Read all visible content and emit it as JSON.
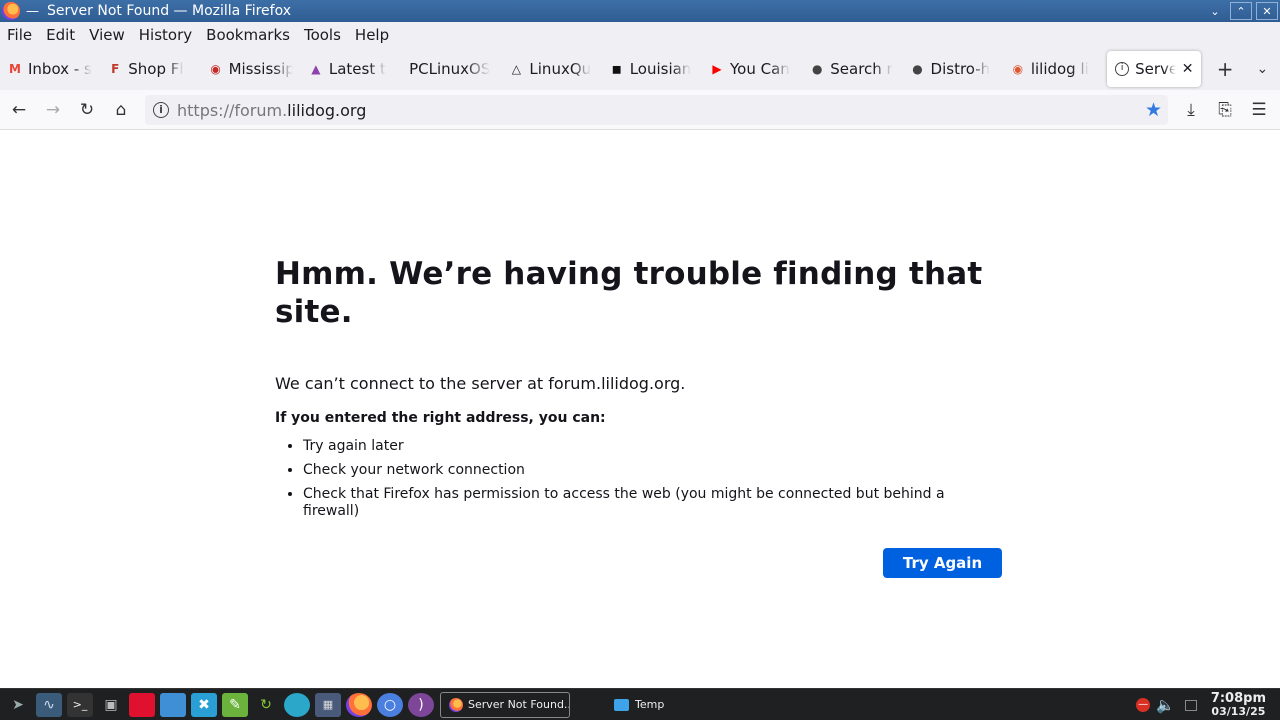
{
  "window": {
    "title": "Server Not Found — Mozilla Firefox"
  },
  "menu": [
    "File",
    "Edit",
    "View",
    "History",
    "Bookmarks",
    "Tools",
    "Help"
  ],
  "tabs": [
    {
      "label": "Inbox - s",
      "icon": "gmail-icon",
      "color": "#ea4335"
    },
    {
      "label": "Shop Fl",
      "icon": "shop-icon",
      "color": "#c0392b"
    },
    {
      "label": "Mississip",
      "icon": "mississippi-icon",
      "color": "#c62828"
    },
    {
      "label": "Latest t",
      "icon": "triangle-icon",
      "color": "#8e44ad"
    },
    {
      "label": "PCLinuxOS",
      "icon": "",
      "color": "#555555"
    },
    {
      "label": "LinuxQu",
      "icon": "tux-icon",
      "color": "#222222"
    },
    {
      "label": "Louisian",
      "icon": "louisiana-icon",
      "color": "#111111"
    },
    {
      "label": "You Can",
      "icon": "youtube-icon",
      "color": "#ff0000"
    },
    {
      "label": "Search r",
      "icon": "flame-icon",
      "color": "#444444"
    },
    {
      "label": "Distro-h",
      "icon": "flame-icon",
      "color": "#444444"
    },
    {
      "label": "lilidog li",
      "icon": "duckduckgo-icon",
      "color": "#de5833"
    }
  ],
  "active_tab": {
    "label": "Server"
  },
  "url": {
    "prefix": "https://forum.",
    "host": "lilidog.org"
  },
  "error": {
    "heading": "Hmm. We’re having trouble finding that site.",
    "lead": "We can’t connect to the server at forum.lilidog.org.",
    "sub": "If you entered the right address, you can:",
    "items": [
      "Try again later",
      "Check your network connection",
      "Check that Firefox has permission to access the web (you might be connected but behind a firewall)"
    ],
    "button": "Try Again"
  },
  "taskbar": {
    "window_label": "Server Not Found...",
    "folder_label": "Temp",
    "time": "7:08pm",
    "date": "03/13/25"
  },
  "colors": {
    "accent": "#0061e0",
    "star": "#3478e2",
    "titlebar": "#2f5d93"
  }
}
